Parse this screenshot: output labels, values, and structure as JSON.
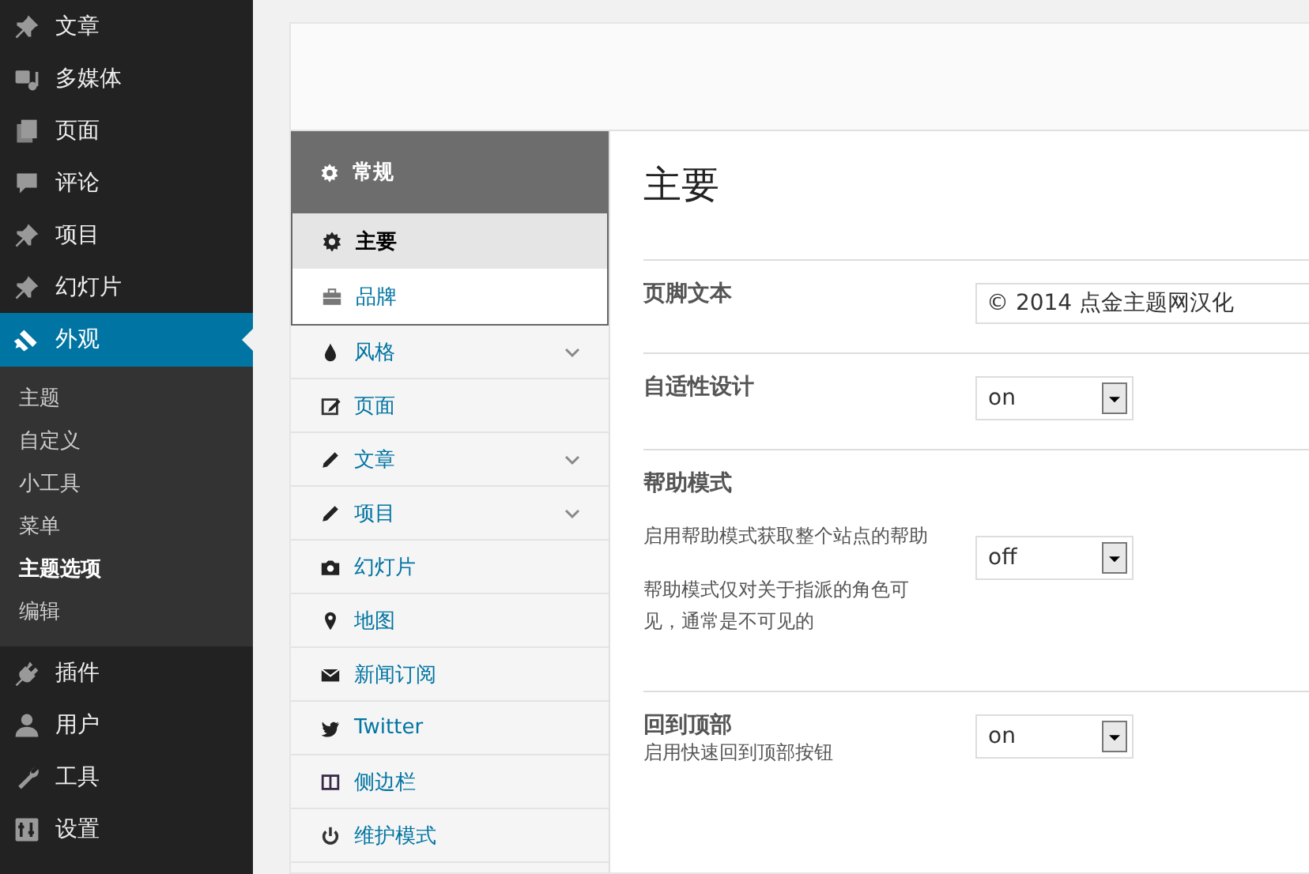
{
  "admin_menu": [
    {
      "label": "文章",
      "selected": false
    },
    {
      "label": "多媒体",
      "selected": false
    },
    {
      "label": "页面",
      "selected": false
    },
    {
      "label": "评论",
      "selected": false
    },
    {
      "label": "项目",
      "selected": false
    },
    {
      "label": "幻灯片",
      "selected": false
    },
    {
      "label": "外观",
      "selected": true,
      "children": [
        {
          "label": "主题",
          "selected": false
        },
        {
          "label": "自定义",
          "selected": false
        },
        {
          "label": "小工具",
          "selected": false
        },
        {
          "label": "菜单",
          "selected": false
        },
        {
          "label": "主题选项",
          "selected": true
        },
        {
          "label": "编辑",
          "selected": false
        }
      ]
    },
    {
      "label": "插件",
      "selected": false
    },
    {
      "label": "用户",
      "selected": false
    },
    {
      "label": "工具",
      "selected": false
    },
    {
      "label": "设置",
      "selected": false
    }
  ],
  "options_nav": {
    "group": {
      "label": "常规",
      "children": [
        {
          "label": "主要",
          "selected": true
        },
        {
          "label": "品牌",
          "selected": false
        }
      ]
    },
    "items": [
      {
        "label": "风格",
        "has_submenu": true
      },
      {
        "label": "页面",
        "has_submenu": false
      },
      {
        "label": "文章",
        "has_submenu": true
      },
      {
        "label": "项目",
        "has_submenu": true
      },
      {
        "label": "幻灯片",
        "has_submenu": false
      },
      {
        "label": "地图",
        "has_submenu": false
      },
      {
        "label": "新闻订阅",
        "has_submenu": false
      },
      {
        "label": "Twitter",
        "has_submenu": false
      },
      {
        "label": "侧边栏",
        "has_submenu": false
      },
      {
        "label": "维护模式",
        "has_submenu": false
      }
    ]
  },
  "section": {
    "title": "主要",
    "rows": [
      {
        "label": "页脚文本",
        "kind": "text",
        "value": "© 2014 点金主题网汉化"
      },
      {
        "label": "自适性设计",
        "kind": "select",
        "value": "on"
      },
      {
        "label": "帮助模式",
        "kind": "select",
        "value": "off",
        "descriptions": [
          "启用帮助模式获取整个站点的帮助",
          "帮助模式仅对关于指派的角色可见，通常是不可见的"
        ]
      },
      {
        "label": "回到顶部",
        "kind": "select",
        "value": "on",
        "subtitle": "启用快速回到顶部按钮"
      }
    ]
  }
}
